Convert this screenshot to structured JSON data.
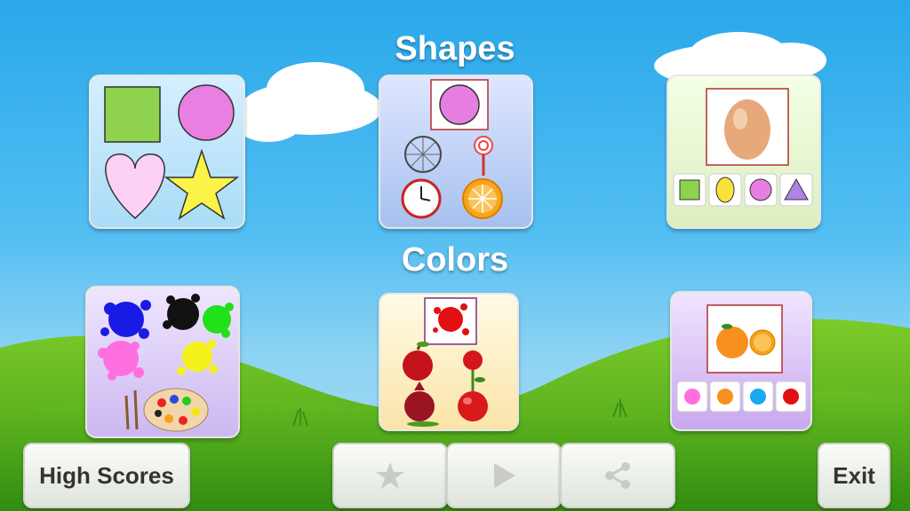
{
  "sections": {
    "shapes_title": "Shapes",
    "colors_title": "Colors"
  },
  "cards": [
    {
      "id": "shapes-learn",
      "section": "Shapes",
      "icon": "basic-shapes-icon"
    },
    {
      "id": "shapes-match",
      "section": "Shapes",
      "icon": "shape-objects-icon"
    },
    {
      "id": "shapes-quiz",
      "section": "Shapes",
      "icon": "egg-shape-quiz-icon"
    },
    {
      "id": "colors-learn",
      "section": "Colors",
      "icon": "paint-splashes-icon"
    },
    {
      "id": "colors-match",
      "section": "Colors",
      "icon": "red-objects-icon"
    },
    {
      "id": "colors-quiz",
      "section": "Colors",
      "icon": "orange-color-quiz-icon"
    }
  ],
  "toolbar": {
    "high_scores_label": "High Scores",
    "exit_label": "Exit",
    "rate_icon": "star-icon",
    "play_icon": "play-icon",
    "share_icon": "share-icon"
  },
  "colors": {
    "sky": "#29a8ea",
    "grass": "#4aa51b",
    "title": "#ffffff"
  }
}
